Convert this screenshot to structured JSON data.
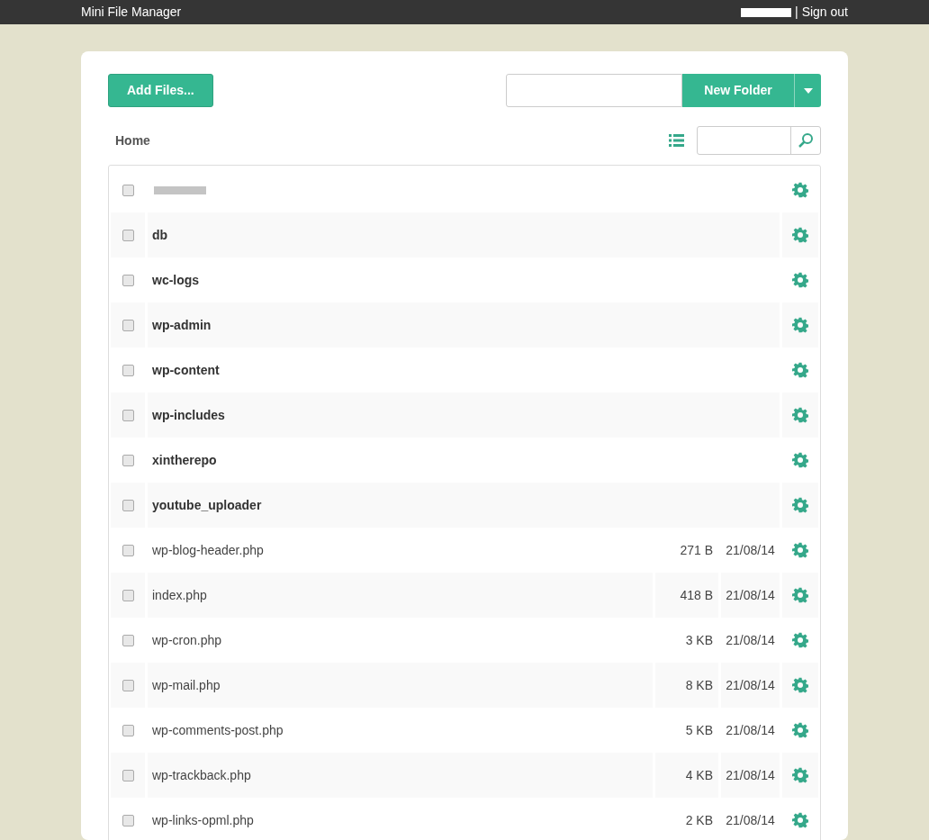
{
  "header": {
    "title": "Mini File Manager",
    "separator": "|",
    "sign_out": "Sign out"
  },
  "toolbar": {
    "add_files": "Add Files...",
    "new_folder": "New Folder"
  },
  "breadcrumb": "Home",
  "rows": [
    {
      "kind": "redacted",
      "checked": false
    },
    {
      "kind": "folder",
      "name": "db",
      "checked": false
    },
    {
      "kind": "folder",
      "name": "wc-logs",
      "checked": false
    },
    {
      "kind": "folder",
      "name": "wp-admin",
      "checked": false
    },
    {
      "kind": "folder",
      "name": "wp-content",
      "checked": false
    },
    {
      "kind": "folder",
      "name": "wp-includes",
      "checked": false
    },
    {
      "kind": "folder",
      "name": "xintherepo",
      "checked": false
    },
    {
      "kind": "folder",
      "name": "youtube_uploader",
      "checked": false
    },
    {
      "kind": "file",
      "name": "wp-blog-header.php",
      "size": "271 B",
      "date": "21/08/14",
      "checked": false
    },
    {
      "kind": "file",
      "name": "index.php",
      "size": "418 B",
      "date": "21/08/14",
      "checked": false
    },
    {
      "kind": "file",
      "name": "wp-cron.php",
      "size": "3 KB",
      "date": "21/08/14",
      "checked": false
    },
    {
      "kind": "file",
      "name": "wp-mail.php",
      "size": "8 KB",
      "date": "21/08/14",
      "checked": false
    },
    {
      "kind": "file",
      "name": "wp-comments-post.php",
      "size": "5 KB",
      "date": "21/08/14",
      "checked": false
    },
    {
      "kind": "file",
      "name": "wp-trackback.php",
      "size": "4 KB",
      "date": "21/08/14",
      "checked": false
    },
    {
      "kind": "file",
      "name": "wp-links-opml.php",
      "size": "2 KB",
      "date": "21/08/14",
      "checked": false
    }
  ]
}
